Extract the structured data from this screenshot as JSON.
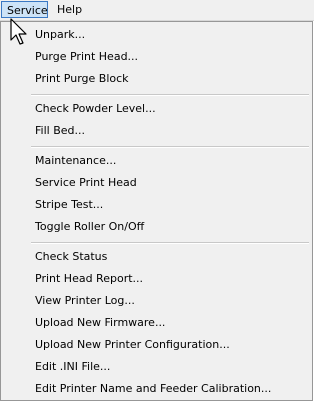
{
  "menubar": {
    "items": [
      {
        "label": "Service"
      },
      {
        "label": "Help"
      }
    ]
  },
  "menu": {
    "items": [
      {
        "label": "Unpark..."
      },
      {
        "label": "Purge Print Head..."
      },
      {
        "label": "Print Purge Block"
      },
      {
        "label": "Check Powder Level..."
      },
      {
        "label": "Fill Bed..."
      },
      {
        "label": "Maintenance..."
      },
      {
        "label": "Service Print Head"
      },
      {
        "label": "Stripe Test..."
      },
      {
        "label": "Toggle Roller On/Off"
      },
      {
        "label": "Check Status"
      },
      {
        "label": "Print Head Report..."
      },
      {
        "label": "View Printer Log..."
      },
      {
        "label": "Upload New Firmware..."
      },
      {
        "label": "Upload New Printer Configuration..."
      },
      {
        "label": "Edit .INI File..."
      },
      {
        "label": "Edit Printer Name and Feeder Calibration..."
      }
    ]
  },
  "icons": {
    "cursor": "mouse-pointer-icon"
  }
}
